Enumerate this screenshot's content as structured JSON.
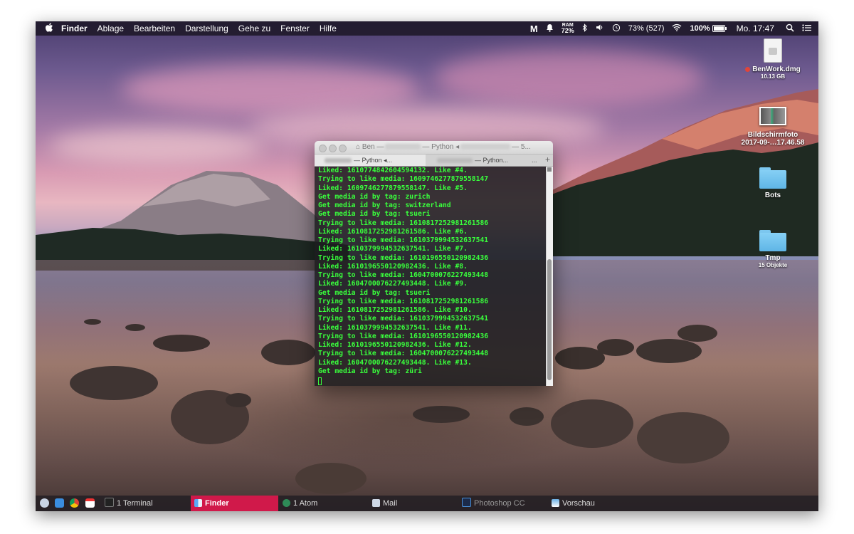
{
  "menubar": {
    "apple": "",
    "items": [
      "Finder",
      "Ablage",
      "Bearbeiten",
      "Darstellung",
      "Gehe zu",
      "Fenster",
      "Hilfe"
    ],
    "status": {
      "ram_label": "RAM",
      "ram_value": "72%",
      "battery_text": "73% (527)",
      "wifi_battery": "100%",
      "clock": "Mo. 17:47"
    }
  },
  "desktop_icons": [
    {
      "name": "BenWork.dmg",
      "sub": "10.13 GB"
    },
    {
      "name": "Bildschirmfoto",
      "sub": "2017-09-…17.46.58"
    },
    {
      "name": "Bots",
      "sub": ""
    },
    {
      "name": "Tmp",
      "sub": "15 Objekte"
    }
  ],
  "terminal": {
    "title_left": "Ben —",
    "title_mid": "— Python ◂",
    "title_right": "— 5...",
    "tab1": "— Python ◂...",
    "tab2": "— Python...",
    "tab_more": "...",
    "tab_plus": "+",
    "lines": [
      "Liked: 1610774842604594132. Like #4.",
      "Trying to like media: 1609746277879558147",
      "Liked: 1609746277879558147. Like #5.",
      "Get media id by tag: zurich",
      "Get media id by tag: switzerland",
      "Get media id by tag: tsueri",
      "Trying to like media: 1610817252981261586",
      "Liked: 1610817252981261586. Like #6.",
      "Trying to like media: 1610379994532637541",
      "Liked: 1610379994532637541. Like #7.",
      "Trying to like media: 1610196550120982436",
      "Liked: 1610196550120982436. Like #8.",
      "Trying to like media: 1604700076227493448",
      "Liked: 1604700076227493448. Like #9.",
      "Get media id by tag: tsueri",
      "Trying to like media: 1610817252981261586",
      "Liked: 1610817252981261586. Like #10.",
      "Trying to like media: 1610379994532637541",
      "Liked: 1610379994532637541. Like #11.",
      "Trying to like media: 1610196550120982436",
      "Liked: 1610196550120982436. Like #12.",
      "Trying to like media: 1604700076227493448",
      "Liked: 1604700076227493448. Like #13.",
      "Get media id by tag: züri"
    ]
  },
  "taskbar": {
    "items": [
      {
        "label": "1 Terminal"
      },
      {
        "label": "Finder"
      },
      {
        "label": "1 Atom"
      },
      {
        "label": "Mail"
      },
      {
        "label": "Photoshop CC"
      },
      {
        "label": "Vorschau"
      }
    ]
  },
  "colors": {
    "terminal_text": "#39ff3c",
    "active_task": "#d0194a"
  }
}
